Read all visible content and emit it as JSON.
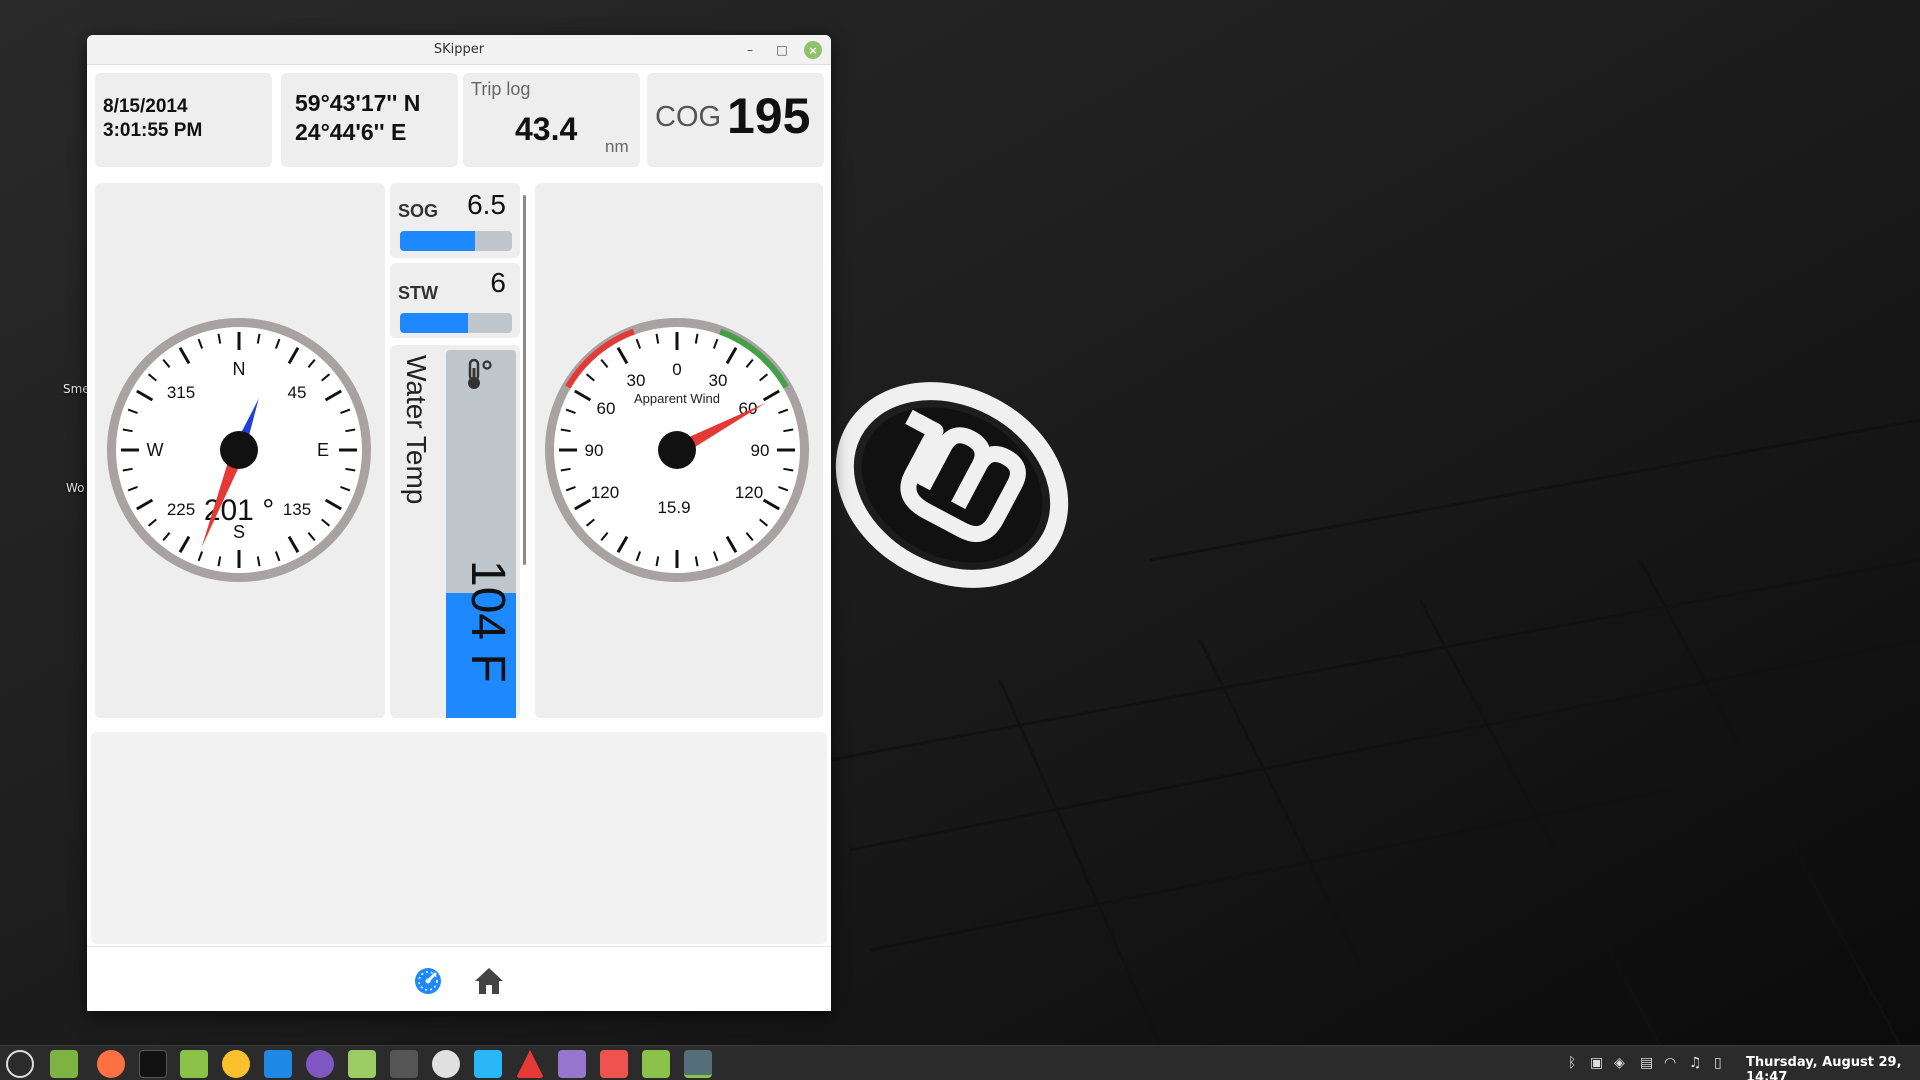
{
  "desktop": {
    "icon_labels": [
      "Sme",
      "Wo"
    ]
  },
  "window": {
    "title": "SKipper",
    "controls": {
      "minimize": "–",
      "maximize": "□",
      "close": "×"
    }
  },
  "datetime": {
    "date": "8/15/2014",
    "time": "3:01:55 PM"
  },
  "position": {
    "lat": "59°43'17'' N",
    "lon": "24°44'6'' E"
  },
  "trip_log": {
    "label": "Trip log",
    "value": "43.4",
    "unit": "nm"
  },
  "cog": {
    "label": "COG",
    "value": "195"
  },
  "sog": {
    "label": "SOG",
    "value": "6.5",
    "fill_fraction": 0.67
  },
  "stw": {
    "label": "STW",
    "value": "6",
    "fill_fraction": 0.61
  },
  "water_temp": {
    "label": "Water Temp",
    "value": "104 F",
    "fill_fraction": 0.34,
    "icon": "thermometer-icon"
  },
  "compass": {
    "cardinals": {
      "n": "N",
      "e": "E",
      "s": "S",
      "w": "W"
    },
    "ticks": {
      "t45": "45",
      "t135": "135",
      "t225": "225",
      "t315": "315"
    },
    "heading_text": "201 °",
    "heading_deg": 201
  },
  "wind": {
    "label": "Apparent Wind",
    "ticks": {
      "z": "0",
      "r30": "30",
      "l30": "30",
      "r60": "60",
      "l60": "60",
      "r90": "90",
      "l90": "90",
      "r120": "120",
      "l120": "120"
    },
    "speed": "15.9",
    "angle_deg": 62,
    "port_color": "#e53935",
    "starboard_color": "#43a047"
  },
  "nav": {
    "dashboard_icon": "dashboard-icon",
    "home_icon": "home-icon"
  },
  "taskbar": {
    "clock": "Thursday, August 29, 14:47",
    "apps": [
      "menu-icon",
      "files-icon",
      "firefox-icon",
      "terminal-icon",
      "folder-icon",
      "chrome-icon",
      "vscode-icon",
      "github-icon",
      "monitor-icon",
      "calculator-icon",
      "search-icon",
      "screenshot-icon",
      "skipper-icon",
      "text-editor-icon",
      "glasses-icon",
      "folder2-icon",
      "skipper-active-icon"
    ]
  },
  "colors": {
    "accent": "#1e88ff",
    "needle_red": "#e53935",
    "needle_blue": "#1e3fd9"
  }
}
